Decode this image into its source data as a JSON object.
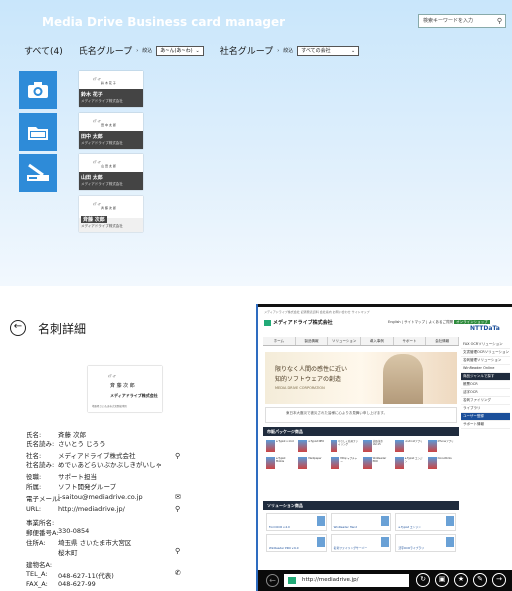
{
  "app": {
    "title": "Media Drive Business card manager",
    "search_placeholder": "検索キーワードを入力"
  },
  "filters": {
    "all": "すべて(4)",
    "name_group": "氏名グループ",
    "narrow1": "絞込",
    "name_select": "あ~ん(あ~わ)",
    "company_group": "社名グループ",
    "narrow2": "絞込",
    "company_select": "すべての会社"
  },
  "cards": [
    {
      "company_mark": "ﾒﾃﾞｨｱ",
      "name_line": "鈴  木  花  子",
      "label": "鈴木 花子",
      "firm": "メディアドライブ株式会社"
    },
    {
      "company_mark": "ﾒﾃﾞｨｱ",
      "name_line": "田  中  太  郎",
      "label": "田中 太郎",
      "firm": "メディアドライブ株式会社"
    },
    {
      "company_mark": "ﾒﾃﾞｨｱ",
      "name_line": "山  田  太  郎",
      "label": "山田 太郎",
      "firm": "メディアドライブ株式会社"
    },
    {
      "company_mark": "ﾒﾃﾞｨｱ",
      "name_line": "斉  藤  次  郎",
      "label": "斉藤 次郎",
      "firm": "メディアドライブ株式会社"
    }
  ],
  "detail": {
    "title": "名刺詳細",
    "card_preview": {
      "a": "ﾒﾃﾞｨｱ",
      "b": "斉 藤 次 郎",
      "c": "メディアドライブ株式会社",
      "d": "埼玉県さいたま市大宮区桜木町"
    },
    "fields": [
      {
        "k": "氏名:",
        "v": "斉藤  次郎"
      },
      {
        "k": "氏名読み:",
        "v": "さいとう じろう"
      },
      {
        "k": "社名:",
        "v": "メディアドライブ株式会社"
      },
      {
        "k": "社名読み:",
        "v": "めでぃあどらいぶかぶしきがいしゃ"
      },
      {
        "k": "役職:",
        "v": "サポート担当"
      },
      {
        "k": "所属:",
        "v": "ソフト開発グループ"
      },
      {
        "k": "電子メール:",
        "v": "j-saitou@mediadrive.co.jp"
      },
      {
        "k": "URL:",
        "v": "http://mediadrive.jp/"
      },
      {
        "k": "事業所名:",
        "v": ""
      },
      {
        "k": "郵便番号A:",
        "v": "330-0854"
      },
      {
        "k": "住所A:",
        "v": "埼玉県 さいたま市大宮区"
      },
      {
        "k": "",
        "v": "桜木町"
      },
      {
        "k": "建物名A:",
        "v": ""
      },
      {
        "k": "TEL_A:",
        "v": "048-627-11(代表)"
      },
      {
        "k": "FAX_A:",
        "v": "048-627-99"
      }
    ]
  },
  "browser": {
    "top_text": "メディアドライブ株式会社  記者発表資料  会社案内  お問い合わせ  サイトマップ",
    "company": "メディアドライブ株式会社",
    "links": [
      "English",
      "サイトマップ",
      "よくあるご質問"
    ],
    "shop": "オンラインショップ",
    "ntt": "NTTDaTa",
    "nav": [
      "ホーム",
      "製品情報",
      "ソリューション",
      "導入事例",
      "サポート",
      "会社情報"
    ],
    "hero_line1": "限りなく人間の感性に近い",
    "hero_line2": "知的ソフトウェアの創造",
    "hero_brand": "MEDIA DRIVE CORPORATION",
    "notice": "東日本大震災で被災された皆様に心よりお見舞い申し上げます。",
    "packages_title": "市販パッケージ商品",
    "packages": [
      "e.Typist v.14.0",
      "e.Typist NEO",
      "やさしく名刺ファイリング",
      "読取革命 Ver.15",
      "Androidアプリ",
      "iPhoneアプリ",
      "e.Typist Mobile",
      "Medipaper",
      "MDキャプチャー",
      "WinReader PRO",
      "e.Typist エンジン",
      "DocuWorks"
    ],
    "solutions_title": "ソリューション商品",
    "solutions": [
      "FormOCR v.4.0",
      "WinReader Hand",
      "e.Typist エンジン",
      "WinReader PRO v.6.0",
      "名刺ファイリングサーバー",
      "活字OCRライブラリ"
    ],
    "side": [
      "FAX OCRソリューション",
      "文書管理OCRソリューション",
      "名刺管理ソリューション",
      "WinReader Online",
      "商品ジャンルで探す",
      "帳票OCR",
      "活字OCR",
      "名刺ファイリング",
      "ライブラリ",
      "ユーザー登録",
      "サポート情報"
    ],
    "url": "http://mediadrive.jp/"
  }
}
